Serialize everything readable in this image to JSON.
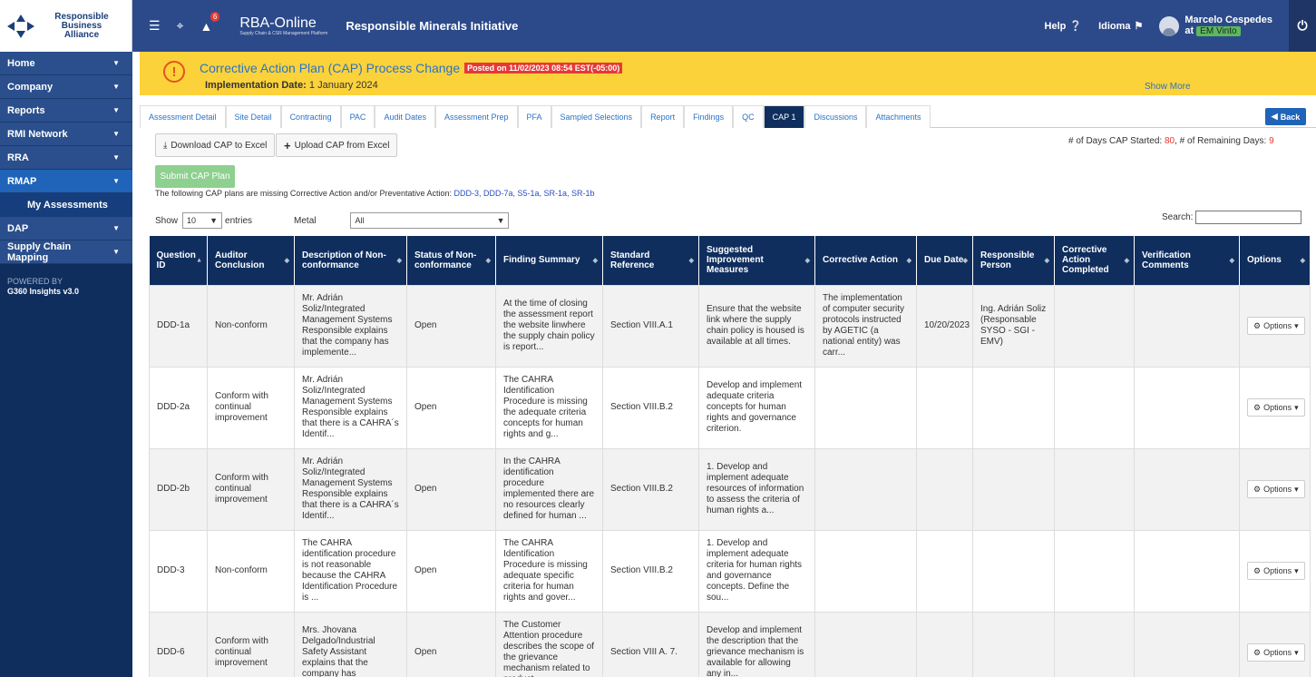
{
  "brand": {
    "line1": "Responsible",
    "line2": "Business",
    "line3": "Alliance"
  },
  "topbar": {
    "notif_count": "6",
    "rba_name": "RBA-Online",
    "rba_tagline": "Supply Chain & CSR Management Platform",
    "app_title": "Responsible Minerals Initiative",
    "help": "Help",
    "idioma": "Idioma",
    "user_name": "Marcelo Cespedes",
    "user_at": "at",
    "user_org": "EM Vinto"
  },
  "sidebar": {
    "items": [
      {
        "label": "Home"
      },
      {
        "label": "Company"
      },
      {
        "label": "Reports"
      },
      {
        "label": "RMI Network"
      },
      {
        "label": "RRA"
      },
      {
        "label": "RMAP"
      },
      {
        "label": "My Assessments"
      },
      {
        "label": "DAP"
      },
      {
        "label": "Supply Chain Mapping"
      }
    ],
    "powered_by": "POWERED BY",
    "powered_name": "G360 Insights v3.0"
  },
  "banner": {
    "title": "Corrective Action Plan (CAP) Process Change",
    "posted": "Posted on 11/02/2023 08:54 EST(-05:00)",
    "impl_label": "Implementation Date:",
    "impl_value": "1 January 2024",
    "show_more": "Show More"
  },
  "tabs": [
    "Assessment Detail",
    "Site Detail",
    "Contracting",
    "PAC",
    "Audit Dates",
    "Assessment Prep",
    "PFA",
    "Sampled Selections",
    "Report",
    "Findings",
    "QC",
    "CAP 1",
    "Discussions",
    "Attachments"
  ],
  "back": "Back",
  "toolbar": {
    "download": "Download CAP to Excel",
    "upload": "Upload CAP from Excel",
    "days_started_label": "# of Days CAP Started:",
    "days_started": "80",
    "days_remaining_label": ", # of Remaining Days:",
    "days_remaining": "9",
    "submit": "Submit CAP Plan",
    "missing_text": "The following CAP plans are missing Corrective Action and/or Preventative Action:",
    "missing_ids": "DDD-3, DDD-7a, S5-1a, SR-1a, SR-1b"
  },
  "filters": {
    "show": "Show",
    "entries_value": "10",
    "entries": "entries",
    "metal": "Metal",
    "metal_value": "All",
    "search": "Search:"
  },
  "columns": [
    "Question ID",
    "Auditor Conclusion",
    "Description of Non-conformance",
    "Status of Non-conformance",
    "Finding Summary",
    "Standard Reference",
    "Suggested Improvement Measures",
    "Corrective Action",
    "Due Date",
    "Responsible Person",
    "Corrective Action Completed",
    "Verification Comments",
    "Options"
  ],
  "rows": [
    {
      "id": "DDD-1a",
      "conclusion": "Non-conform",
      "description": "Mr. Adrián Soliz/Integrated Management Systems Responsible explains that the company has implemente...",
      "status": "Open",
      "summary": "At the time of closing the assessment report the website linwhere the supply chain policy is report...",
      "reference": "Section VIII.A.1",
      "measures": "Ensure that the website link where the supply chain policy is housed is available at all times.",
      "action": "The implementation of computer security protocols instructed by AGETIC (a national entity) was carr...",
      "due": "10/20/2023",
      "person": "Ing. Adrián Soliz (Responsable SYSO - SGI - EMV)",
      "completed": "",
      "verification": "",
      "options": "Options"
    },
    {
      "id": "DDD-2a",
      "conclusion": "Conform with continual improvement",
      "description": "Mr. Adrián Soliz/Integrated Management Systems Responsible explains that there is a CAHRA´s Identif...",
      "status": "Open",
      "summary": "The CAHRA Identification Procedure is missing the adequate criteria concepts for human rights and g...",
      "reference": "Section VIII.B.2",
      "measures": "Develop and implement adequate criteria concepts for human rights and governance criterion.",
      "action": "",
      "due": "",
      "person": "",
      "completed": "",
      "verification": "",
      "options": "Options"
    },
    {
      "id": "DDD-2b",
      "conclusion": "Conform with continual improvement",
      "description": "Mr. Adrián Soliz/Integrated Management Systems Responsible explains that there is a CAHRA´s Identif...",
      "status": "Open",
      "summary": "In the CAHRA identification procedure implemented there are no resources clearly defined for human ...",
      "reference": "Section VIII.B.2",
      "measures": "1. Develop and implement adequate resources of information to assess the criteria of human rights a...",
      "action": "",
      "due": "",
      "person": "",
      "completed": "",
      "verification": "",
      "options": "Options"
    },
    {
      "id": "DDD-3",
      "conclusion": "Non-conform",
      "description": "The CAHRA identification procedure is not reasonable because the CAHRA Identification Procedure is ...",
      "status": "Open",
      "summary": "The CAHRA Identification Procedure is missing adequate specific criteria for human rights and gover...",
      "reference": "Section VIII.B.2",
      "measures": "1. Develop and implement adequate criteria for human rights and governance concepts. Define the sou...",
      "action": "",
      "due": "",
      "person": "",
      "completed": "",
      "verification": "",
      "options": "Options"
    },
    {
      "id": "DDD-6",
      "conclusion": "Conform with continual improvement",
      "description": "Mrs. Jhovana Delgado/Industrial Safety Assistant explains that the company has",
      "status": "Open",
      "summary": "The Customer Attention procedure describes the scope of the grievance mechanism related to product...",
      "reference": "Section VIII A. 7.",
      "measures": "Develop and implement the description that the grievance mechanism is available for allowing any in...",
      "action": "",
      "due": "",
      "person": "",
      "completed": "",
      "verification": "",
      "options": "Options"
    }
  ],
  "colors": {
    "topbar": "#2c4a8a",
    "sidebar": "#0f2e5e",
    "banner": "#fcd23a",
    "header": "#0f2e5e",
    "accent": "#2a73c7"
  }
}
